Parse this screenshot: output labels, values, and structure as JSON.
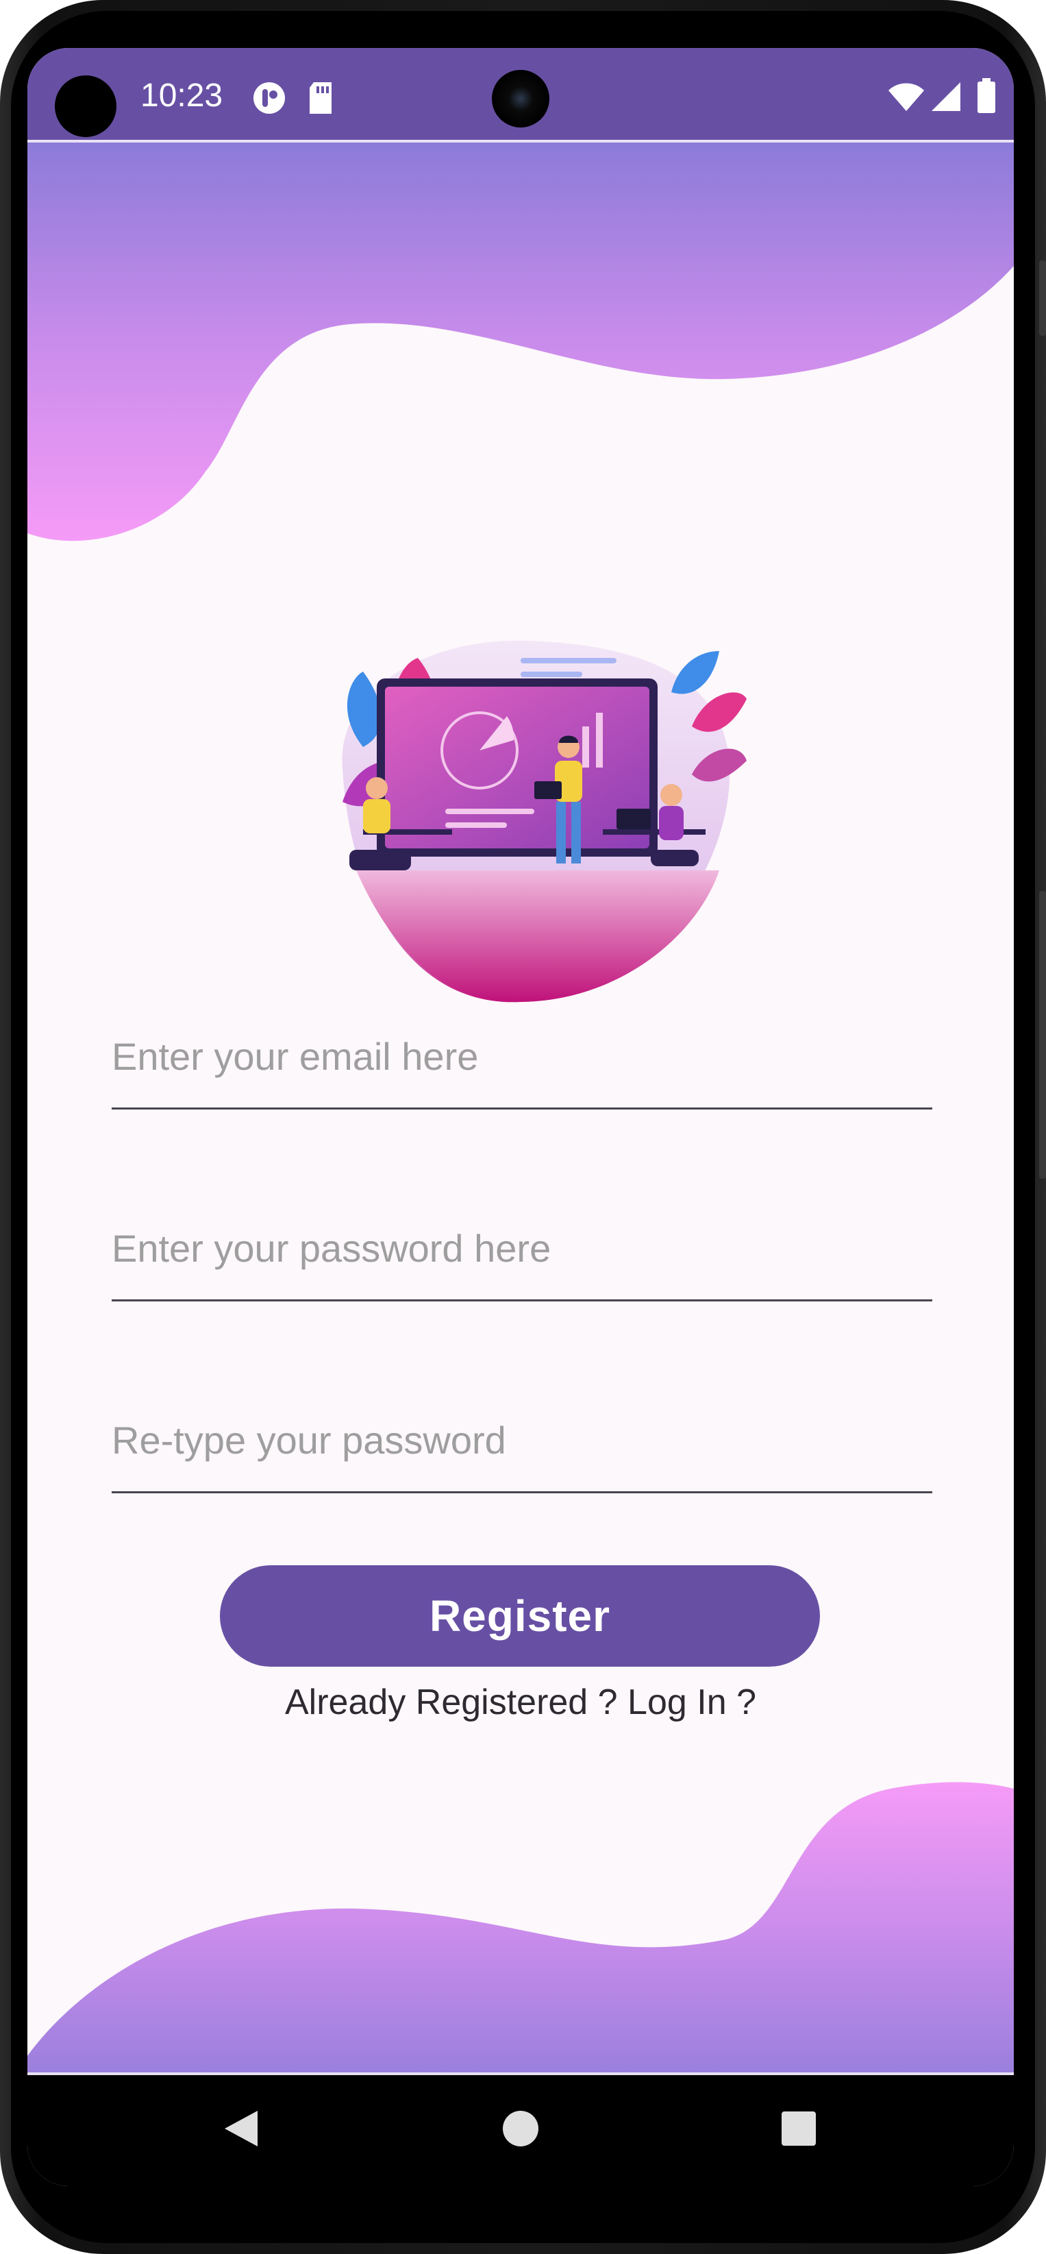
{
  "status_bar": {
    "time": "10:23",
    "left_icons": [
      "accessibility-icon",
      "sd-card-icon"
    ],
    "right_icons": [
      "wifi-icon",
      "signal-icon",
      "battery-icon"
    ]
  },
  "illustration": {
    "name": "team-presentation-illustration"
  },
  "form": {
    "email_placeholder": "Enter your email here",
    "password_placeholder": "Enter your password here",
    "retype_placeholder": "Re-type your password",
    "register_label": "Register",
    "login_link": "Already Registered ? Log In ?"
  },
  "nav_bar": {
    "buttons": [
      "back-icon",
      "home-icon",
      "recents-icon"
    ]
  },
  "colors": {
    "primary": "#6750a4",
    "wave_top_start": "#8b78d8",
    "wave_pink": "#f69cf7",
    "background": "#fdf8fb"
  }
}
